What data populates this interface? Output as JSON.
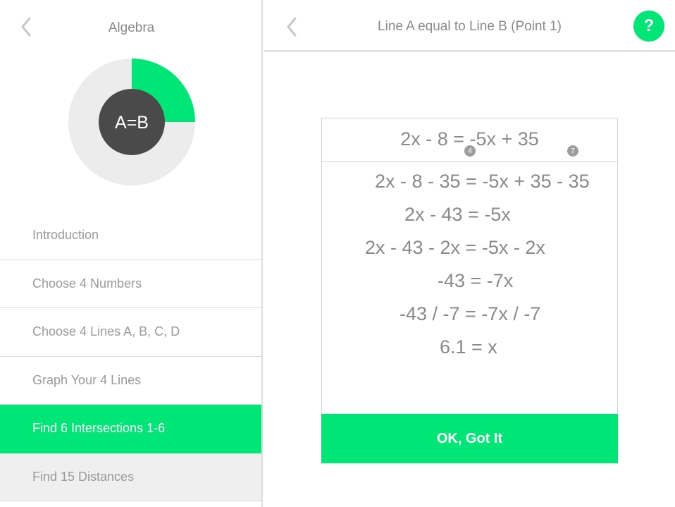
{
  "sidebar": {
    "title": "Algebra",
    "progress": {
      "center_label": "A=B",
      "fraction_complete": 0.25,
      "fill_color": "#00e676",
      "track_color": "#ececec",
      "center_color": "#4a4a4a"
    },
    "items": [
      {
        "label": "Introduction",
        "state": "normal"
      },
      {
        "label": "Choose 4 Numbers",
        "state": "normal"
      },
      {
        "label": "Choose 4 Lines A, B, C, D",
        "state": "normal"
      },
      {
        "label": "Graph Your 4 Lines",
        "state": "normal"
      },
      {
        "label": "Find 6 Intersections 1-6",
        "state": "active"
      },
      {
        "label": "Find 15 Distances",
        "state": "dim"
      }
    ],
    "back_icon": "chevron-left-icon"
  },
  "main": {
    "title": "Line A equal to Line B (Point 1)",
    "back_icon": "chevron-left-icon",
    "help_label": "?",
    "card": {
      "equation": "2x - 8 = -5x + 35",
      "badges": [
        "4",
        "7"
      ],
      "steps": [
        "2x - 8 - 35 = -5x + 35 - 35",
        "2x - 43 = -5x",
        "2x - 43 - 2x = -5x - 2x",
        "-43 = -7x",
        "-43 / -7 = -7x / -7",
        "6.1 = x"
      ],
      "ok_label": "OK, Got It"
    }
  },
  "colors": {
    "accent": "#00e676",
    "text": "#8a8a8a",
    "divider": "#dcdcdc"
  }
}
